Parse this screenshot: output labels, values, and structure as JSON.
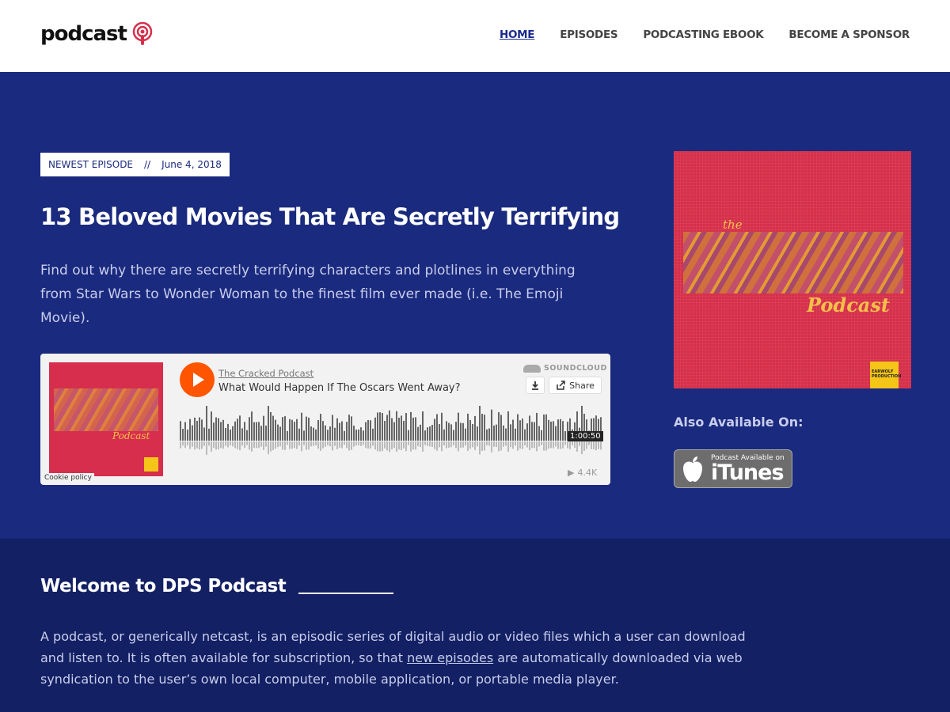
{
  "header": {
    "logo_text": "podcast",
    "nav": {
      "home": "HOME",
      "episodes": "EPISODES",
      "ebook": "PODCASTING EBOOK",
      "sponsor": "BECOME A SPONSOR"
    }
  },
  "hero": {
    "badge_label": "NEWEST EPISODE",
    "badge_separator": "//",
    "badge_date": "June 4, 2018",
    "title": "13 Beloved Movies That Are Secretly Terrifying",
    "description": "Find out why there are secretly terrifying characters and plotlines in everything from Star Wars to Wonder Woman to the finest film ever made (i.e. The Emoji Movie).",
    "player": {
      "author": "The Cracked Podcast",
      "track": "What Would Happen If The Oscars Went Away?",
      "brand": "SOUNDCLOUD",
      "share_label": "Share",
      "duration": "1:00:50",
      "plays": "4.4K",
      "cookie_label": "Cookie policy",
      "art_word": "Podcast"
    },
    "cover": {
      "the": "the",
      "word": "Podcast",
      "corner_text": "EARWOLF PRODUCTION"
    },
    "also_available": "Also Available On:",
    "itunes_small": "Podcast Available on",
    "itunes_big": "iTunes"
  },
  "welcome": {
    "title": "Welcome to DPS Podcast",
    "text_before": "A podcast, or generically netcast, is an episodic series of digital audio or video files which a user can download and listen to. It is often available for subscription, so that ",
    "link_text": "new episodes",
    "text_after": " are automatically downloaded via web syndication to the user’s own local computer, mobile application, or portable media player."
  },
  "colors": {
    "brand_red": "#d6304b",
    "hero_bg": "#1a2a7e",
    "welcome_bg": "#132063",
    "soundcloud_orange": "#ff5500"
  }
}
